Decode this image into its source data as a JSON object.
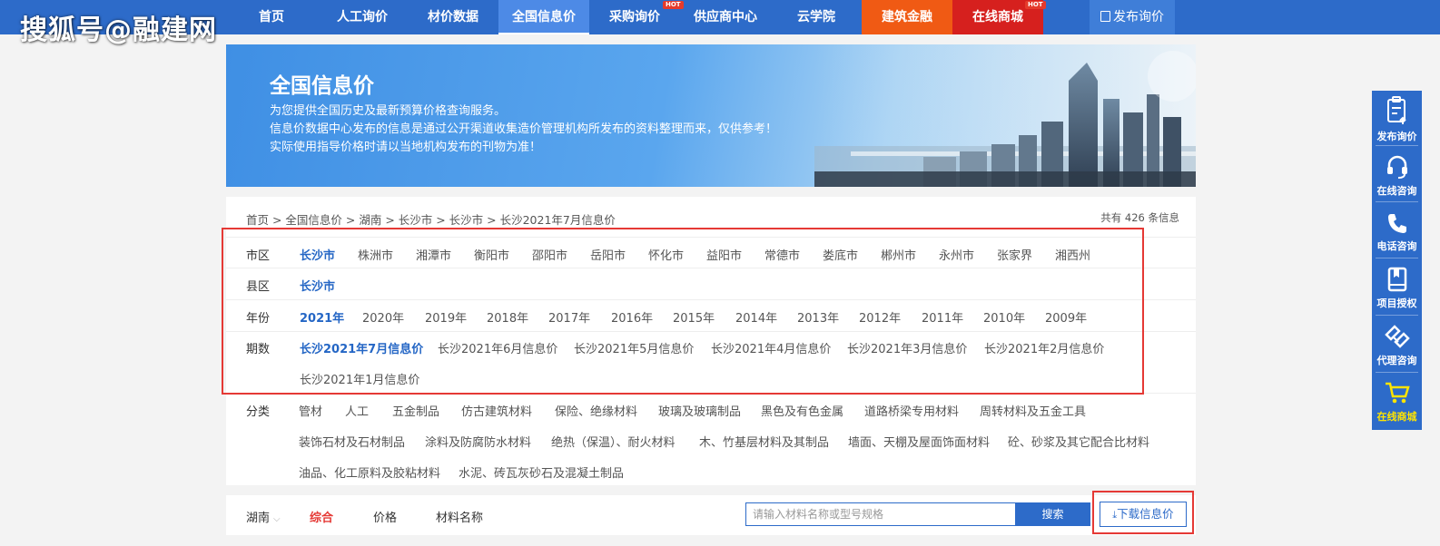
{
  "watermark": "搜狐号@融建网",
  "nav": {
    "items": [
      "首页",
      "人工询价",
      "材价数据",
      "全国信息价",
      "采购询价",
      "供应商中心",
      "云学院",
      "建筑金融",
      "在线商城"
    ],
    "hot": "HOT",
    "publish": "发布询价",
    "active_color": "#4d8ae6",
    "finance_color": "#f05a14",
    "mall_color": "#d6201e"
  },
  "banner": {
    "title": "全国信息价",
    "line1": "为您提供全国历史及最新预算价格查询服务。",
    "line2": "信息价数据中心发布的信息是通过公开渠道收集造价管理机构所发布的资料整理而来，仅供参考！",
    "line3": "实际使用指导价格时请以当地机构发布的刊物为准！"
  },
  "breadcrumb": "首页 > 全国信息价 > 湖南 > 长沙市 > 长沙市 > 长沙2021年7月信息价",
  "total": "共有 426 条信息",
  "filters": {
    "city_label": "市区",
    "cities": [
      "长沙市",
      "株洲市",
      "湘潭市",
      "衡阳市",
      "邵阳市",
      "岳阳市",
      "怀化市",
      "益阳市",
      "常德市",
      "娄底市",
      "郴州市",
      "永州市",
      "张家界",
      "湘西州"
    ],
    "county_label": "县区",
    "counties": [
      "长沙市"
    ],
    "year_label": "年份",
    "years": [
      "2021年",
      "2020年",
      "2019年",
      "2018年",
      "2017年",
      "2016年",
      "2015年",
      "2014年",
      "2013年",
      "2012年",
      "2011年",
      "2010年",
      "2009年"
    ],
    "period_label": "期数",
    "periods": [
      "长沙2021年7月信息价",
      "长沙2021年6月信息价",
      "长沙2021年5月信息价",
      "长沙2021年4月信息价",
      "长沙2021年3月信息价",
      "长沙2021年2月信息价",
      "长沙2021年1月信息价"
    ],
    "category_label": "分类",
    "categories": [
      "管材",
      "人工",
      "五金制品",
      "仿古建筑材料",
      "保险、绝缘材料",
      "玻璃及玻璃制品",
      "黑色及有色金属",
      "道路桥梁专用材料",
      "周转材料及五金工具",
      "装饰石材及石材制品",
      "涂料及防腐防水材料",
      "绝热（保温）、耐火材料",
      "木、竹基层材料及其制品",
      "墙面、天棚及屋面饰面材料",
      "砼、砂浆及其它配合比材料",
      "油品、化工原料及胶粘材料",
      "水泥、砖瓦灰砂石及混凝土制品"
    ]
  },
  "searchbar": {
    "region": "湖南",
    "tab_all": "综合",
    "tab_price": "价格",
    "tab_name": "材料名称",
    "placeholder": "请输入材料名称或型号规格",
    "search_label": "搜索",
    "download_label": "下载信息价"
  },
  "sidebar": {
    "items": [
      "发布询价",
      "在线咨询",
      "电话咨询",
      "项目授权",
      "代理咨询",
      "在线商城"
    ]
  }
}
